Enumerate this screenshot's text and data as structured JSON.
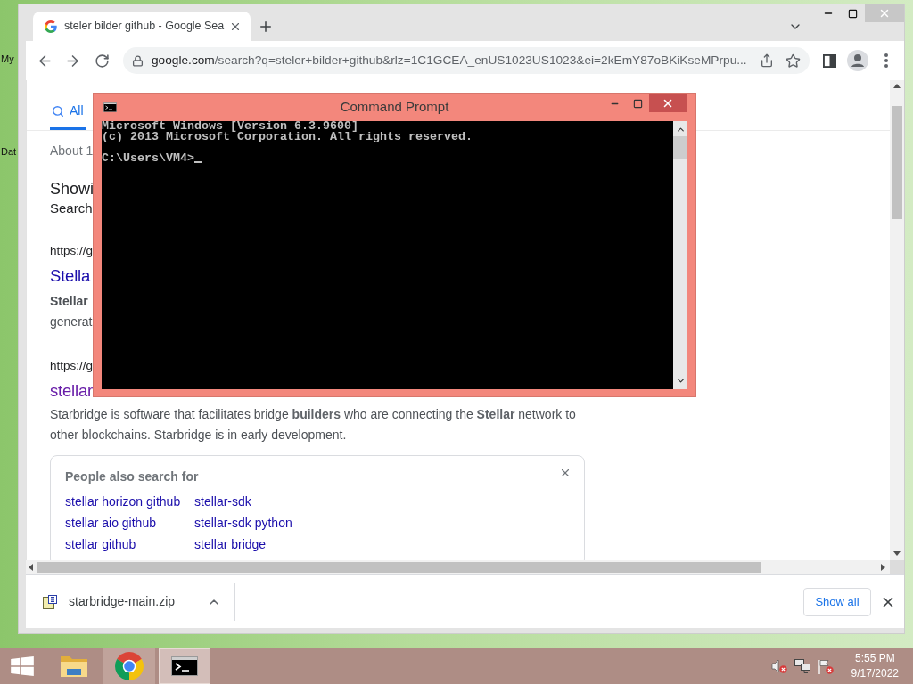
{
  "desktop": {
    "icons": [
      {
        "label": "My"
      },
      {
        "label": "Dat"
      }
    ]
  },
  "browser": {
    "tabs": [
      {
        "title": "steler bilder github - Google Sea",
        "selected": true
      }
    ],
    "address": {
      "host": "google.com",
      "rest": "/search?q=steler+bilder+github&rlz=1C1GCEA_enUS1023US1023&ei=2kEmY87oBKiKseMPrpu..."
    },
    "search_tabs": [
      {
        "label": "All",
        "selected": true
      }
    ],
    "result_stats": "About 1",
    "spelling_notice": {
      "heading": "Showi",
      "line": "Search"
    },
    "results": [
      {
        "url": "https://g",
        "title": "Stella",
        "visited": false,
        "snippet_lines": [
          {
            "text": "Stellar",
            "bold": true
          },
          {
            "text": "generat",
            "bold": false
          }
        ]
      },
      {
        "url": "https://g",
        "title": "stellar",
        "visited": true,
        "snippet": "Starbridge is software that facilitates bridge **builders** who are connecting the **Stellar** network to other blockchains. Starbridge is in early development."
      }
    ],
    "people_also_search": {
      "title": "People also search for",
      "items": [
        "stellar horizon github",
        "stellar-sdk",
        "stellar aio github",
        "stellar-sdk python",
        "stellar github",
        "stellar bridge"
      ]
    },
    "downloads": {
      "items": [
        {
          "file": "starbridge-main.zip"
        }
      ],
      "show_all": "Show all"
    }
  },
  "console_window": {
    "title": "Command Prompt",
    "output": [
      "Microsoft Windows [Version 6.3.9600]",
      "(c) 2013 Microsoft Corporation. All rights reserved."
    ],
    "prompt": "C:\\Users\\VM4>"
  },
  "taskbar": {
    "apps": [
      {
        "kind": "explorer",
        "running": false,
        "selected": false
      },
      {
        "kind": "chrome",
        "running": true,
        "selected": false
      },
      {
        "kind": "console",
        "running": true,
        "selected": true
      }
    ],
    "clock": {
      "time": "5:55 PM",
      "date": "9/17/2022"
    }
  }
}
